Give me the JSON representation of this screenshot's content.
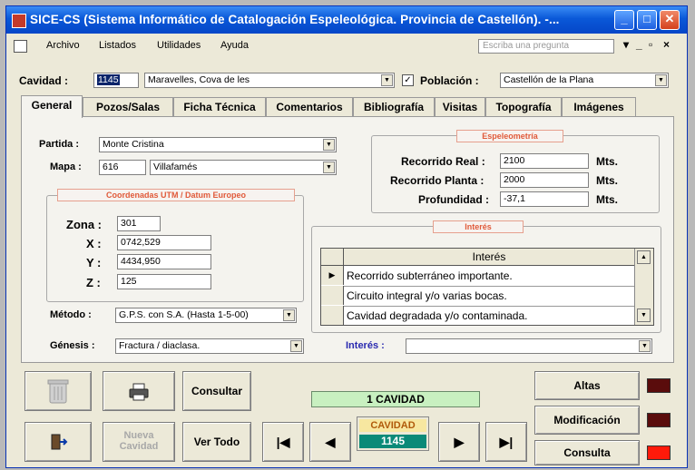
{
  "window": {
    "title": "SICE-CS (Sistema Informático de Catalogación Espeleológica.  Provincia de Castellón). -..."
  },
  "menu": {
    "items": [
      "Archivo",
      "Listados",
      "Utilidades",
      "Ayuda"
    ],
    "ask_placeholder": "Escriba una pregunta"
  },
  "header": {
    "cavidad_label": "Cavidad :",
    "cavidad_code": "1145",
    "cavidad_name": "Maravelles, Cova de les",
    "poblacion_label": "Población :",
    "poblacion_value": "Castellón de la Plana"
  },
  "tabs": [
    "General",
    "Pozos/Salas",
    "Ficha Técnica",
    "Comentarios",
    "Bibliografía",
    "Visitas",
    "Topografía",
    "Imágenes"
  ],
  "general": {
    "partida_label": "Partida :",
    "partida_value": "Monte Cristina",
    "mapa_label": "Mapa :",
    "mapa_num": "616",
    "mapa_name": "Villafamés",
    "utm_title": "Coordenadas UTM  /  Datum Europeo",
    "zona_label": "Zona :",
    "zona_value": "301",
    "x_label": "X :",
    "x_value": "0742,529",
    "y_label": "Y :",
    "y_value": "4434,950",
    "z_label": "Z :",
    "z_value": "125",
    "metodo_label": "Método :",
    "metodo_value": "G.P.S. con S.A. (Hasta 1-5-00)",
    "genesis_label": "Génesis :",
    "genesis_value": "Fractura / diaclasa.",
    "espeleo_title": "Espeleometría",
    "recorrido_real_label": "Recorrido Real :",
    "recorrido_real_value": "2100",
    "recorrido_planta_label": "Recorrido Planta :",
    "recorrido_planta_value": "2000",
    "profundidad_label": "Profundidad :",
    "profundidad_value": "-37,1",
    "unit": "Mts.",
    "interes_title": "Interés",
    "interes_header": "Interés",
    "interes_rows": [
      "Recorrido subterráneo importante.",
      "Circuito integral y/o varias bocas.",
      "Cavidad degradada y/o contaminada."
    ],
    "interes_label": "Interés :"
  },
  "bottom": {
    "consultar": "Consultar",
    "nueva_line1": "Nueva",
    "nueva_line2": "Cavidad",
    "ver_todo": "Ver Todo",
    "record_count": "1 CAVIDAD",
    "cavidad_label": "CAVIDAD",
    "cavidad_value": "1145",
    "altas": "Altas",
    "modificacion": "Modificación",
    "consulta": "Consulta"
  },
  "colors": {
    "indicator_off": "#5a0c0c",
    "indicator_on": "#ff1a0a",
    "counter_bg": "#c8f0c0",
    "cavidad_value_bg": "#0a8a78"
  }
}
